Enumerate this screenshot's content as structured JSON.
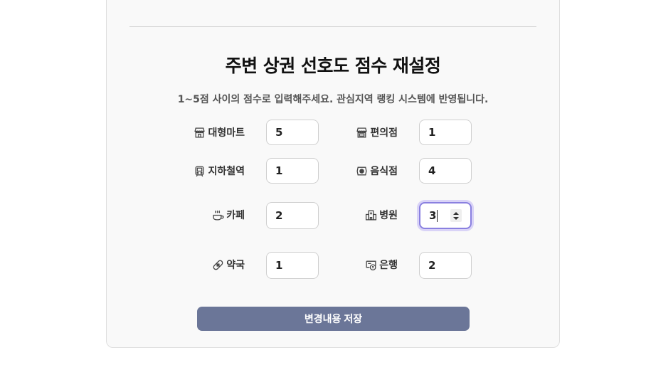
{
  "form": {
    "title": "주변 상권 선호도 점수 재설정",
    "subtitle": "1~5점 사이의 점수로 입력해주세요. 관심지역 랭킹 시스템에 반영됩니다.",
    "fields": [
      {
        "label": "대형마트",
        "value": "5",
        "icon": "store-icon"
      },
      {
        "label": "편의점",
        "value": "1",
        "icon": "shop-icon"
      },
      {
        "label": "지하철역",
        "value": "1",
        "icon": "subway-icon"
      },
      {
        "label": "음식점",
        "value": "4",
        "icon": "plate-icon"
      },
      {
        "label": "카페",
        "value": "2",
        "icon": "coffee-icon"
      },
      {
        "label": "병원",
        "value": "3",
        "icon": "hospital-icon"
      },
      {
        "label": "약국",
        "value": "1",
        "icon": "bandage-icon"
      },
      {
        "label": "은행",
        "value": "2",
        "icon": "bank-icon"
      }
    ],
    "save_label": "변경내용 저장"
  },
  "colors": {
    "save_button": "#6b7698",
    "top_left_button": "#6d799c",
    "top_right_button": "#e23d4a",
    "focus_ring": "#8a80e0"
  }
}
